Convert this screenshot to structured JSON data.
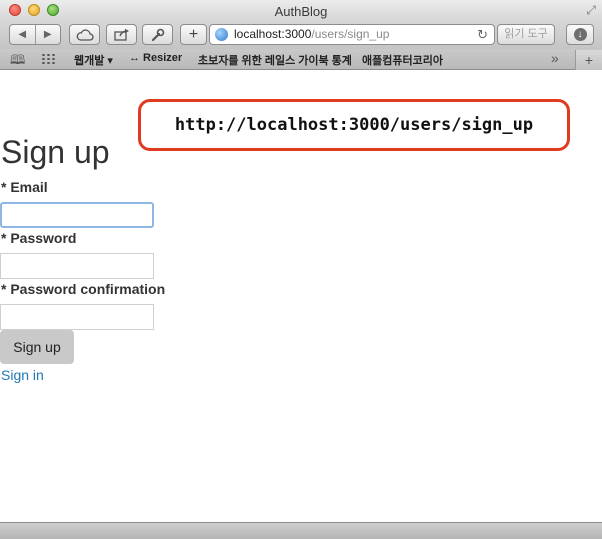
{
  "window": {
    "title": "AuthBlog"
  },
  "toolbar": {
    "back_glyph": "◀",
    "forward_glyph": "▶",
    "add_glyph": "+",
    "url_host": "localhost:3000",
    "url_path": "/users/sign_up",
    "reload_glyph": "↻",
    "reader_label": "읽기 도구"
  },
  "bookmarks": {
    "items": [
      "웹개발 ▾",
      "↔ Resizer",
      "초보자를 위한 레일스 가이북 통계",
      "애플컴퓨터코리아"
    ],
    "more_glyph": "»",
    "newtab_glyph": "+"
  },
  "annotation": {
    "url_text": "http://localhost:3000/users/sign_up"
  },
  "page": {
    "heading": "Sign up",
    "required_marker": "*",
    "email_label": "Email",
    "password_label": "Password",
    "password_confirmation_label": "Password confirmation",
    "email_value": "",
    "password_value": "",
    "password_confirmation_value": "",
    "submit_label": "Sign up",
    "signin_link": "Sign in"
  },
  "colors": {
    "callout_border": "#e03b1e",
    "link": "#1f78b4",
    "focus_ring": "#8fb6e0"
  }
}
